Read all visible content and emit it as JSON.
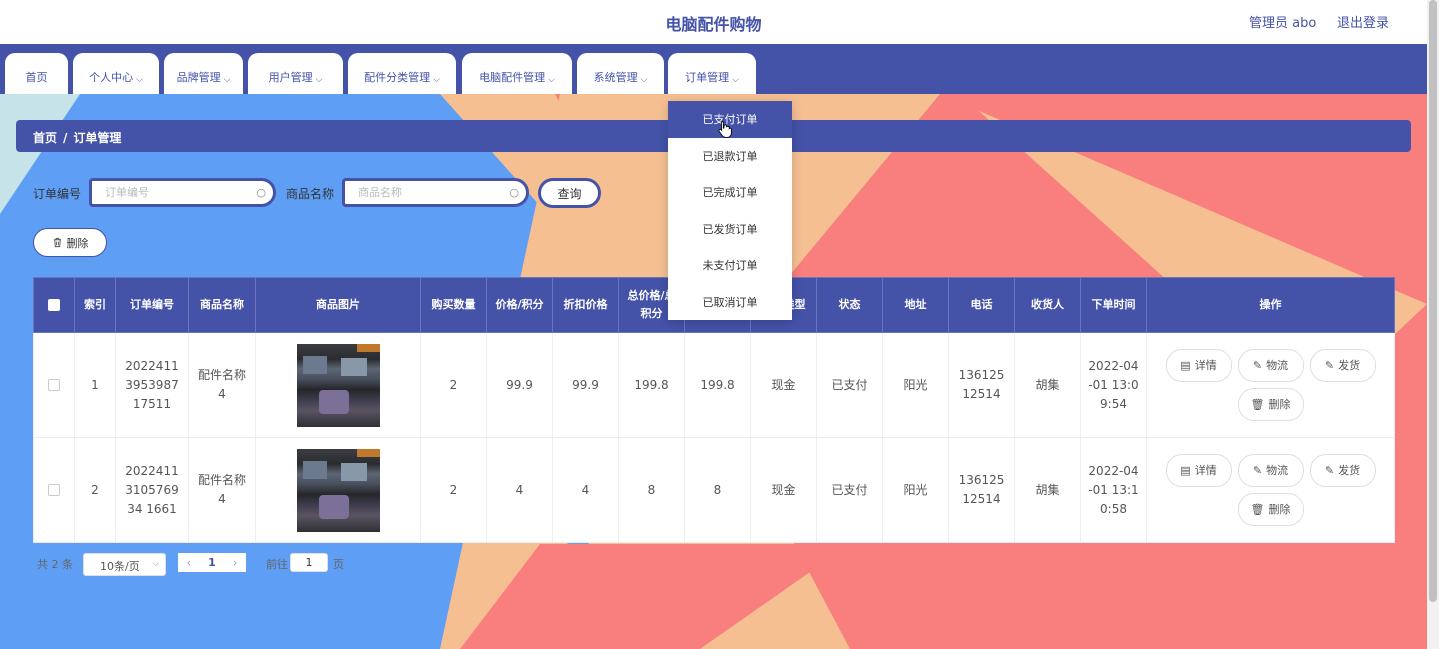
{
  "header": {
    "title": "电脑配件购物",
    "user": "管理员 abo",
    "logout": "退出登录"
  },
  "nav": [
    {
      "label": "首页",
      "has_chevron": false
    },
    {
      "label": "个人中心",
      "has_chevron": true
    },
    {
      "label": "品牌管理",
      "has_chevron": true
    },
    {
      "label": "用户管理",
      "has_chevron": true
    },
    {
      "label": "配件分类管理",
      "has_chevron": true
    },
    {
      "label": "电脑配件管理",
      "has_chevron": true
    },
    {
      "label": "系统管理",
      "has_chevron": true
    },
    {
      "label": "订单管理",
      "has_chevron": true
    }
  ],
  "nav_chevron": "⌵",
  "dropdown": {
    "items": [
      "已支付订单",
      "已退款订单",
      "已完成订单",
      "已发货订单",
      "未支付订单",
      "已取消订单"
    ],
    "active_index": 0
  },
  "breadcrumb": {
    "home": "首页",
    "sep": "/",
    "current": "订单管理"
  },
  "search": {
    "order_label": "订单编号",
    "order_placeholder": "订单编号",
    "product_label": "商品名称",
    "product_placeholder": "商品名称",
    "query_button": "查询"
  },
  "delete_button": "删除",
  "table": {
    "headers": [
      "索引",
      "订单编号",
      "商品名称",
      "商品图片",
      "购买数量",
      "价格/积分",
      "折扣价格",
      "总价格/总积分",
      "",
      "支付类型",
      "状态",
      "地址",
      "电话",
      "收货人",
      "下单时间",
      "操作"
    ],
    "rows": [
      {
        "index": "1",
        "order_no": "2022411395398717511",
        "name": "配件名称4",
        "qty": "2",
        "price": "99.9",
        "discount": "99.9",
        "total": "199.8",
        "col9": "199.8",
        "pay_type": "现金",
        "status": "已支付",
        "address": "阳光",
        "phone": "13612512514",
        "receiver": "胡集",
        "time": "2022-04-01 13:09:54"
      },
      {
        "index": "2",
        "order_no": "2022411310576934 1661",
        "name": "配件名称4",
        "qty": "2",
        "price": "4",
        "discount": "4",
        "total": "8",
        "col9": "8",
        "pay_type": "现金",
        "status": "已支付",
        "address": "阳光",
        "phone": "13612512514",
        "receiver": "胡集",
        "time": "2022-04-01 13:10:58"
      }
    ],
    "ops": {
      "detail": "详情",
      "logistics": "物流",
      "ship": "发货",
      "delete": "删除"
    }
  },
  "pagination": {
    "total": "共 2 条",
    "page_size": "10条/页",
    "current_page": "1",
    "goto": "前往",
    "goto_value": "1",
    "page_unit": "页"
  },
  "icons": {
    "search": "search-icon",
    "trash": "trash-icon",
    "doc": "document-icon",
    "edit": "edit-icon",
    "prev": "chevron-left-icon",
    "next": "chevron-right-icon"
  },
  "colors": {
    "primary": "#4452a8",
    "bg_blue": "#5f9ef5",
    "bg_peach": "#f5bf92",
    "bg_coral": "#f97e7e",
    "bg_teal": "#c7e3ea"
  }
}
